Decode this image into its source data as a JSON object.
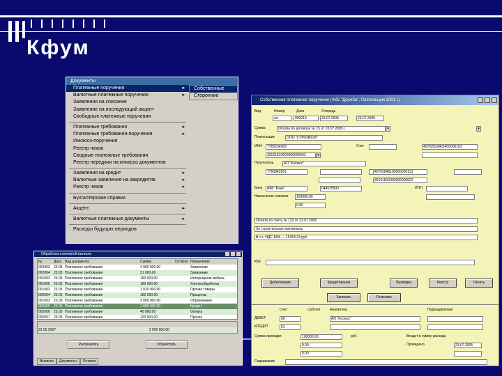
{
  "slide": {
    "title": "Кфум"
  },
  "menu": {
    "bar_label": "Документы",
    "items": [
      {
        "label": "Платежные поручения",
        "arrow": true,
        "hl": true
      },
      {
        "label": "Валютные платежные поручения",
        "arrow": true
      },
      {
        "label": "Заявления на списание",
        "arrow": false
      },
      {
        "label": "Заявление на последующий акцепт",
        "arrow": false
      },
      {
        "label": "Свободные платежные поручения",
        "arrow": false
      },
      {
        "sep": true
      },
      {
        "label": "Платежные требования",
        "arrow": true
      },
      {
        "label": "Платежные требования-поручения",
        "arrow": true
      },
      {
        "label": "Инкассо-поручения",
        "arrow": false
      },
      {
        "label": "Реестр чеков",
        "arrow": false
      },
      {
        "label": "Сводные платежные требования",
        "arrow": false
      },
      {
        "label": "Реестр передачи на инкассо документов",
        "arrow": false
      },
      {
        "sep": true
      },
      {
        "label": "Заявления на кредит",
        "arrow": true
      },
      {
        "label": "Валютные заявления на аккредитив",
        "arrow": true
      },
      {
        "label": "Реестр чеков",
        "arrow": true
      },
      {
        "sep": true
      },
      {
        "label": "Бухгалтерские справки",
        "arrow": false
      },
      {
        "sep": true
      },
      {
        "label": "Акцепт",
        "arrow": true
      },
      {
        "sep": true
      },
      {
        "label": "Валютные платежные документы",
        "arrow": true
      },
      {
        "sep": true
      },
      {
        "label": "Расходы будущих периодов",
        "arrow": false
      }
    ],
    "submenu": [
      {
        "label": "Собственные",
        "hl": true
      },
      {
        "label": "Сторонние",
        "hl": false
      }
    ]
  },
  "list": {
    "title": "Обработка платежной выписки",
    "headers": [
      "№",
      "Дата",
      "Вид документа",
      "",
      "Сумма",
      "Остаток",
      "Назначение",
      ""
    ],
    "rows": [
      {
        "c": [
          "002003",
          "23.05",
          "Платежное требование",
          "",
          "2 000 000.00",
          "",
          "Заявление",
          ""
        ],
        "s": "n"
      },
      {
        "c": [
          "002004",
          "23.05",
          "Платежное требование",
          "",
          "21 000.00",
          "",
          "Заявление",
          ""
        ],
        "s": "a"
      },
      {
        "c": [
          "001003",
          "23.05",
          "Платежное требование",
          "",
          "150 000.00",
          "",
          "Интерьерная мебель",
          ""
        ],
        "s": "n"
      },
      {
        "c": [
          "001006",
          "23.05",
          "Платежное требование",
          "",
          "160 000.00",
          "",
          "Хлопкообработка",
          ""
        ],
        "s": "a"
      },
      {
        "c": [
          "001003",
          "23.05",
          "Платежное требование",
          "",
          "1 020 000.00",
          "",
          "Прочие товары",
          ""
        ],
        "s": "n"
      },
      {
        "c": [
          "002004",
          "23.05",
          "Платежное требование",
          "",
          "100 000.00",
          "",
          "Проценты",
          ""
        ],
        "s": "a"
      },
      {
        "c": [
          "001003",
          "23.05",
          "Платежное требование",
          "",
          "2 000 000.00",
          "",
          "Образование",
          ""
        ],
        "s": "n"
      },
      {
        "c": [
          "002005",
          "23.05",
          "Платежное требование",
          "",
          "1 000 000.00",
          "",
          "Кредит",
          ""
        ],
        "s": "sel"
      },
      {
        "c": [
          "002006",
          "23.05",
          "Платежное требование",
          "",
          "40 000.00",
          "",
          "Оплата",
          ""
        ],
        "s": "a"
      },
      {
        "c": [
          "002007",
          "23.05",
          "Платежное требование",
          "",
          "120 000.00",
          "",
          "Прочее",
          ""
        ],
        "s": "n"
      }
    ],
    "sub_row": [
      "23.05.2007",
      "",
      "2 000 000.00",
      ""
    ],
    "btn1": "Распечатать",
    "btn2": "Обработать",
    "tabs": [
      "Выписки",
      "Документы",
      "Остатки"
    ]
  },
  "form": {
    "title": "Собственное платежное поручение (АКБ \"Дружба\", Плательщик 2001 г.)",
    "labels": {
      "type": "Вид",
      "number": "Номер",
      "date": "Дата",
      "priority": "Очередь",
      "sum": "Сумма",
      "payer": "Плательщик",
      "inn": "ИНН",
      "acc": "Счет",
      "bank": "Банк",
      "bik": "БИК",
      "ks": "к/сч",
      "payee": "Получатель",
      "purpose": "Назначение платежа",
      "kbk": "КБК"
    },
    "values": {
      "type": "эл.",
      "number": "000019",
      "date": "23.07.2005",
      "priority": "23.07.2005",
      "sum_text": "Оплата по договору № 15 от 23.07.2005 г.",
      "payer": "ООО \"СТРОЙКОМ\"",
      "payer_inn": "7765234589",
      "payer_acc": "40702810402400000103",
      "payer_ks": "30101810600000000593",
      "payee": "АО \"Космос\"",
      "payee_inn": "7765843561",
      "payee_acc": "40702840100000000113",
      "payee_bank": "АКБ \"Банк\"",
      "payee_bik": "044525593",
      "payee_ks": "30101810400000000002",
      "amount": "100000.00",
      "nds": "0.00",
      "purpose1": "Оплата по счету № 123 от 23.07.2005",
      "purpose2": "За строительные материалы",
      "purpose3": "В т.ч. НДС 18% — 15254.24 руб."
    },
    "buttons": [
      "Дебетование",
      "Кредитование",
      "Проводки",
      "Реестр",
      "Печать"
    ],
    "ok": "Записать",
    "cancel": "Отменить",
    "bottom": {
      "col_acc": "Счет",
      "col_sub": "Субсчет",
      "col_analytic": "Аналитика",
      "col_div": "Подразделение",
      "debit": "ДЕБЕТ",
      "debit_acc": "60",
      "debit_an": "АО \"Космос\"",
      "credit": "КРЕДИТ",
      "credit_acc": "51",
      "sum_label": "Сумма проводки",
      "sum_val": "100000.00",
      "sum_unit": "руб.",
      "future": "Входит в сумму расхода",
      "posted": "Проведено",
      "posted_date": "23.07.2005",
      "val2": "0.00",
      "val3": "0.00",
      "note": "Содержание"
    }
  }
}
